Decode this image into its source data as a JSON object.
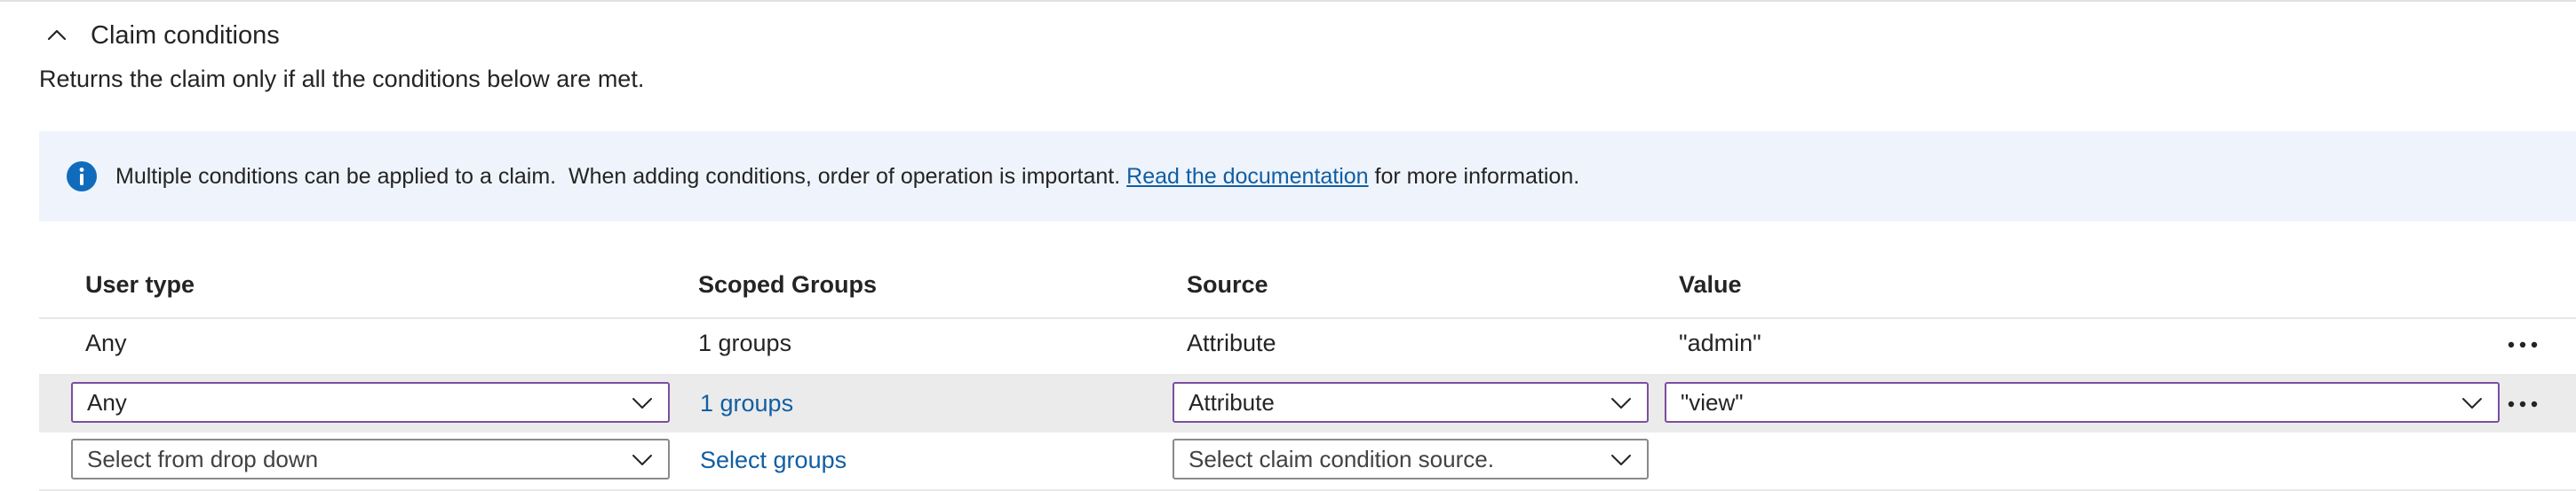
{
  "section": {
    "title": "Claim conditions",
    "subtitle": "Returns the claim only if all the conditions below are met."
  },
  "banner": {
    "text_before": "Multiple conditions can be applied to a claim.  When adding conditions, order of operation is important. ",
    "link": "Read the documentation",
    "text_after": " for more information."
  },
  "table": {
    "headers": [
      "User type",
      "Scoped Groups",
      "Source",
      "Value"
    ],
    "rows": [
      {
        "user_type": "Any",
        "scoped_groups": "1 groups",
        "source": "Attribute",
        "value": "\"admin\""
      },
      {
        "user_type": "Any",
        "scoped_groups": "1 groups",
        "source": "Attribute",
        "value": "\"view\""
      }
    ],
    "new_row": {
      "user_type_placeholder": "Select from drop down",
      "groups_link": "Select groups",
      "source_placeholder": "Select claim condition source."
    }
  },
  "colors": {
    "accent_link": "#115ea3",
    "info_icon": "#0f6cbd",
    "banner_bg": "#eff4fc",
    "active_border": "#7a4fa0"
  },
  "icons": [
    "chevron-up-icon",
    "info-icon",
    "chevron-down-icon",
    "more-options-icon"
  ]
}
